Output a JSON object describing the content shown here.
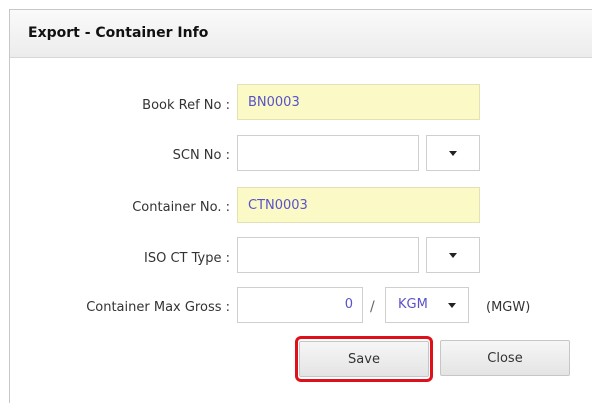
{
  "dialog": {
    "title": "Export - Container Info"
  },
  "form": {
    "book_ref": {
      "label": "Book Ref No :",
      "value": "BN0003"
    },
    "scn": {
      "label": "SCN No :",
      "value": ""
    },
    "container_no": {
      "label": "Container No. :",
      "value": "CTN0003"
    },
    "iso_type": {
      "label": "ISO CT Type :",
      "value": ""
    },
    "max_gross": {
      "label": "Container Max Gross :",
      "value": "0",
      "separator": "/",
      "unit": "KGM",
      "suffix": "(MGW)"
    }
  },
  "buttons": {
    "save": "Save",
    "close": "Close"
  },
  "colors": {
    "required_field_bg": "#fbfac6",
    "value_text": "#5a52c8",
    "highlight_border": "#e0101a"
  }
}
